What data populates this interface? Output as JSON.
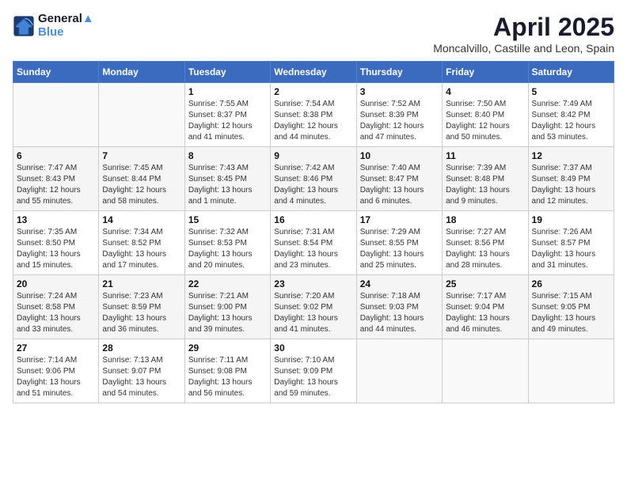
{
  "header": {
    "logo_line1": "General",
    "logo_line2": "Blue",
    "month_title": "April 2025",
    "subtitle": "Moncalvillo, Castille and Leon, Spain"
  },
  "days_of_week": [
    "Sunday",
    "Monday",
    "Tuesday",
    "Wednesday",
    "Thursday",
    "Friday",
    "Saturday"
  ],
  "weeks": [
    [
      {
        "day": "",
        "info": ""
      },
      {
        "day": "",
        "info": ""
      },
      {
        "day": "1",
        "info": "Sunrise: 7:55 AM\nSunset: 8:37 PM\nDaylight: 12 hours and 41 minutes."
      },
      {
        "day": "2",
        "info": "Sunrise: 7:54 AM\nSunset: 8:38 PM\nDaylight: 12 hours and 44 minutes."
      },
      {
        "day": "3",
        "info": "Sunrise: 7:52 AM\nSunset: 8:39 PM\nDaylight: 12 hours and 47 minutes."
      },
      {
        "day": "4",
        "info": "Sunrise: 7:50 AM\nSunset: 8:40 PM\nDaylight: 12 hours and 50 minutes."
      },
      {
        "day": "5",
        "info": "Sunrise: 7:49 AM\nSunset: 8:42 PM\nDaylight: 12 hours and 53 minutes."
      }
    ],
    [
      {
        "day": "6",
        "info": "Sunrise: 7:47 AM\nSunset: 8:43 PM\nDaylight: 12 hours and 55 minutes."
      },
      {
        "day": "7",
        "info": "Sunrise: 7:45 AM\nSunset: 8:44 PM\nDaylight: 12 hours and 58 minutes."
      },
      {
        "day": "8",
        "info": "Sunrise: 7:43 AM\nSunset: 8:45 PM\nDaylight: 13 hours and 1 minute."
      },
      {
        "day": "9",
        "info": "Sunrise: 7:42 AM\nSunset: 8:46 PM\nDaylight: 13 hours and 4 minutes."
      },
      {
        "day": "10",
        "info": "Sunrise: 7:40 AM\nSunset: 8:47 PM\nDaylight: 13 hours and 6 minutes."
      },
      {
        "day": "11",
        "info": "Sunrise: 7:39 AM\nSunset: 8:48 PM\nDaylight: 13 hours and 9 minutes."
      },
      {
        "day": "12",
        "info": "Sunrise: 7:37 AM\nSunset: 8:49 PM\nDaylight: 13 hours and 12 minutes."
      }
    ],
    [
      {
        "day": "13",
        "info": "Sunrise: 7:35 AM\nSunset: 8:50 PM\nDaylight: 13 hours and 15 minutes."
      },
      {
        "day": "14",
        "info": "Sunrise: 7:34 AM\nSunset: 8:52 PM\nDaylight: 13 hours and 17 minutes."
      },
      {
        "day": "15",
        "info": "Sunrise: 7:32 AM\nSunset: 8:53 PM\nDaylight: 13 hours and 20 minutes."
      },
      {
        "day": "16",
        "info": "Sunrise: 7:31 AM\nSunset: 8:54 PM\nDaylight: 13 hours and 23 minutes."
      },
      {
        "day": "17",
        "info": "Sunrise: 7:29 AM\nSunset: 8:55 PM\nDaylight: 13 hours and 25 minutes."
      },
      {
        "day": "18",
        "info": "Sunrise: 7:27 AM\nSunset: 8:56 PM\nDaylight: 13 hours and 28 minutes."
      },
      {
        "day": "19",
        "info": "Sunrise: 7:26 AM\nSunset: 8:57 PM\nDaylight: 13 hours and 31 minutes."
      }
    ],
    [
      {
        "day": "20",
        "info": "Sunrise: 7:24 AM\nSunset: 8:58 PM\nDaylight: 13 hours and 33 minutes."
      },
      {
        "day": "21",
        "info": "Sunrise: 7:23 AM\nSunset: 8:59 PM\nDaylight: 13 hours and 36 minutes."
      },
      {
        "day": "22",
        "info": "Sunrise: 7:21 AM\nSunset: 9:00 PM\nDaylight: 13 hours and 39 minutes."
      },
      {
        "day": "23",
        "info": "Sunrise: 7:20 AM\nSunset: 9:02 PM\nDaylight: 13 hours and 41 minutes."
      },
      {
        "day": "24",
        "info": "Sunrise: 7:18 AM\nSunset: 9:03 PM\nDaylight: 13 hours and 44 minutes."
      },
      {
        "day": "25",
        "info": "Sunrise: 7:17 AM\nSunset: 9:04 PM\nDaylight: 13 hours and 46 minutes."
      },
      {
        "day": "26",
        "info": "Sunrise: 7:15 AM\nSunset: 9:05 PM\nDaylight: 13 hours and 49 minutes."
      }
    ],
    [
      {
        "day": "27",
        "info": "Sunrise: 7:14 AM\nSunset: 9:06 PM\nDaylight: 13 hours and 51 minutes."
      },
      {
        "day": "28",
        "info": "Sunrise: 7:13 AM\nSunset: 9:07 PM\nDaylight: 13 hours and 54 minutes."
      },
      {
        "day": "29",
        "info": "Sunrise: 7:11 AM\nSunset: 9:08 PM\nDaylight: 13 hours and 56 minutes."
      },
      {
        "day": "30",
        "info": "Sunrise: 7:10 AM\nSunset: 9:09 PM\nDaylight: 13 hours and 59 minutes."
      },
      {
        "day": "",
        "info": ""
      },
      {
        "day": "",
        "info": ""
      },
      {
        "day": "",
        "info": ""
      }
    ]
  ]
}
